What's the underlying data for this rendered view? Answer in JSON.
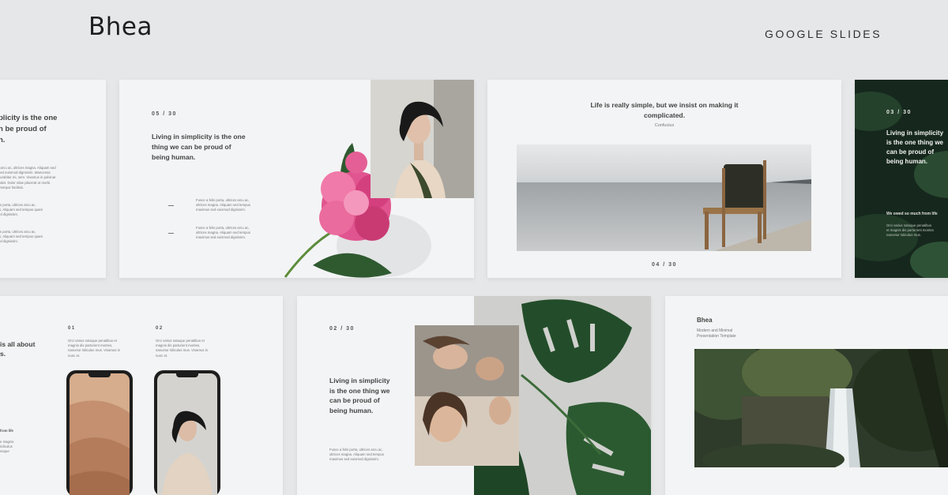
{
  "header": {
    "brand": "Bhea",
    "product": "GOOGLE SLIDES"
  },
  "slide_a": {
    "heading": "plicity  is the one\nn be proud of\nn.",
    "body1": "t arcu ac, ultrices magna. Aliquam sed\n sed euismod dignissim. Maecenas\ncurabitur mi, sem. Vivamus in pulvinar\ncalet. Dolor vitae placerat ut morbi.\nt tempor facilisis.",
    "body2": "lis porta, ultrices arcu ac,\nsi, Aliquam sed tempus quam\ned dignissim.",
    "body3": "lis porta, ultrices arcu ac,\nsi, Aliquam sed tempus quam\nod dignissim."
  },
  "slide_b": {
    "page": "05 / 30",
    "heading": "Living in simplicity  is the one\nthing we can be proud of\nbeing human.",
    "item1": "Fusce a felis porta, ultrices arcu ac,\nultrices magna. Aliquam sed tempus\nmaximus sed euismod dignissim.",
    "item2": "Fusce a felis porta, ultrices arcu ac,\nultrices magna. Aliquam sed tempus\nmaximus sed euismod dignissim."
  },
  "slide_c": {
    "quote": "Life is really simple, but we insist on making it\ncomplicated.",
    "author": "Confucius",
    "page": "04 / 30"
  },
  "slide_d": {
    "page": "03 / 30",
    "heading": "Living in simplicity\nis the one thing we\ncan be proud of\nbeing human.",
    "subhead": "We owed so much from life",
    "body": "Orci varius natoque penatibus\net magnis dis parturient montes\nnascetur ridiculus mus."
  },
  "slide_e": {
    "heading": "is all about\ns.",
    "col1_num": "01",
    "col1_text": "Orci varius natoque penatibus et\nmagnis dis parturient montes,\nnascetur ridiculus mus. Vivamus in\nnunc et.",
    "col2_num": "02",
    "col2_text": "Orci varius natoque penatibus et\nmagnis dis parturient montes,\nnascetur ridiculus mus. Vivamus in\nnunc et.",
    "side_head": "from life",
    "side_text": "e magnis\nridiculus\nsoque"
  },
  "slide_f": {
    "page": "02 / 30",
    "heading": "Living in simplicity\nis the one thing we\ncan be proud of\nbeing human.",
    "body": "Fusce a felis porta, ultrices arcu ac,\nultrices magna. Aliquam sed tempus\nmaximus sed euismod dignissim."
  },
  "slide_g": {
    "title": "Bhea",
    "subtitle": "Modern and Minimal\nPresentation Template"
  },
  "colors": {
    "background": "#e6e7e9",
    "slide": "#f3f4f5",
    "dark_slide": "#16281d",
    "flower": "#e0558f",
    "leaf": "#2f5a30"
  }
}
